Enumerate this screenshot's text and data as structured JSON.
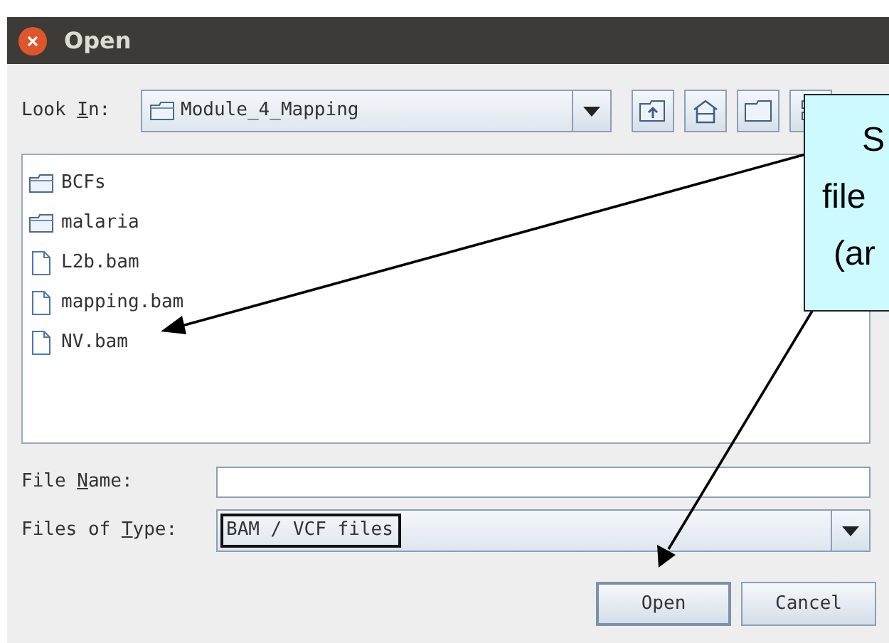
{
  "window": {
    "title": "Open"
  },
  "look_in": {
    "label_parts": [
      "Look ",
      "I",
      "n:"
    ],
    "value": "Module_4_Mapping"
  },
  "files": [
    {
      "name": "BCFs",
      "kind": "folder"
    },
    {
      "name": "malaria",
      "kind": "folder"
    },
    {
      "name": "L2b.bam",
      "kind": "file"
    },
    {
      "name": "mapping.bam",
      "kind": "file"
    },
    {
      "name": "NV.bam",
      "kind": "file"
    }
  ],
  "file_name": {
    "label_parts": [
      "File ",
      "N",
      "ame:"
    ]
  },
  "files_of_type": {
    "label_parts": [
      "Files of ",
      "T",
      "ype:"
    ],
    "value": "BAM / VCF files",
    "highlighted": true
  },
  "buttons": [
    {
      "label": "Open",
      "default": true
    },
    {
      "label": "Cancel",
      "default": false
    }
  ],
  "callout": {
    "lines": [
      "S",
      "file",
      "(ar"
    ]
  }
}
